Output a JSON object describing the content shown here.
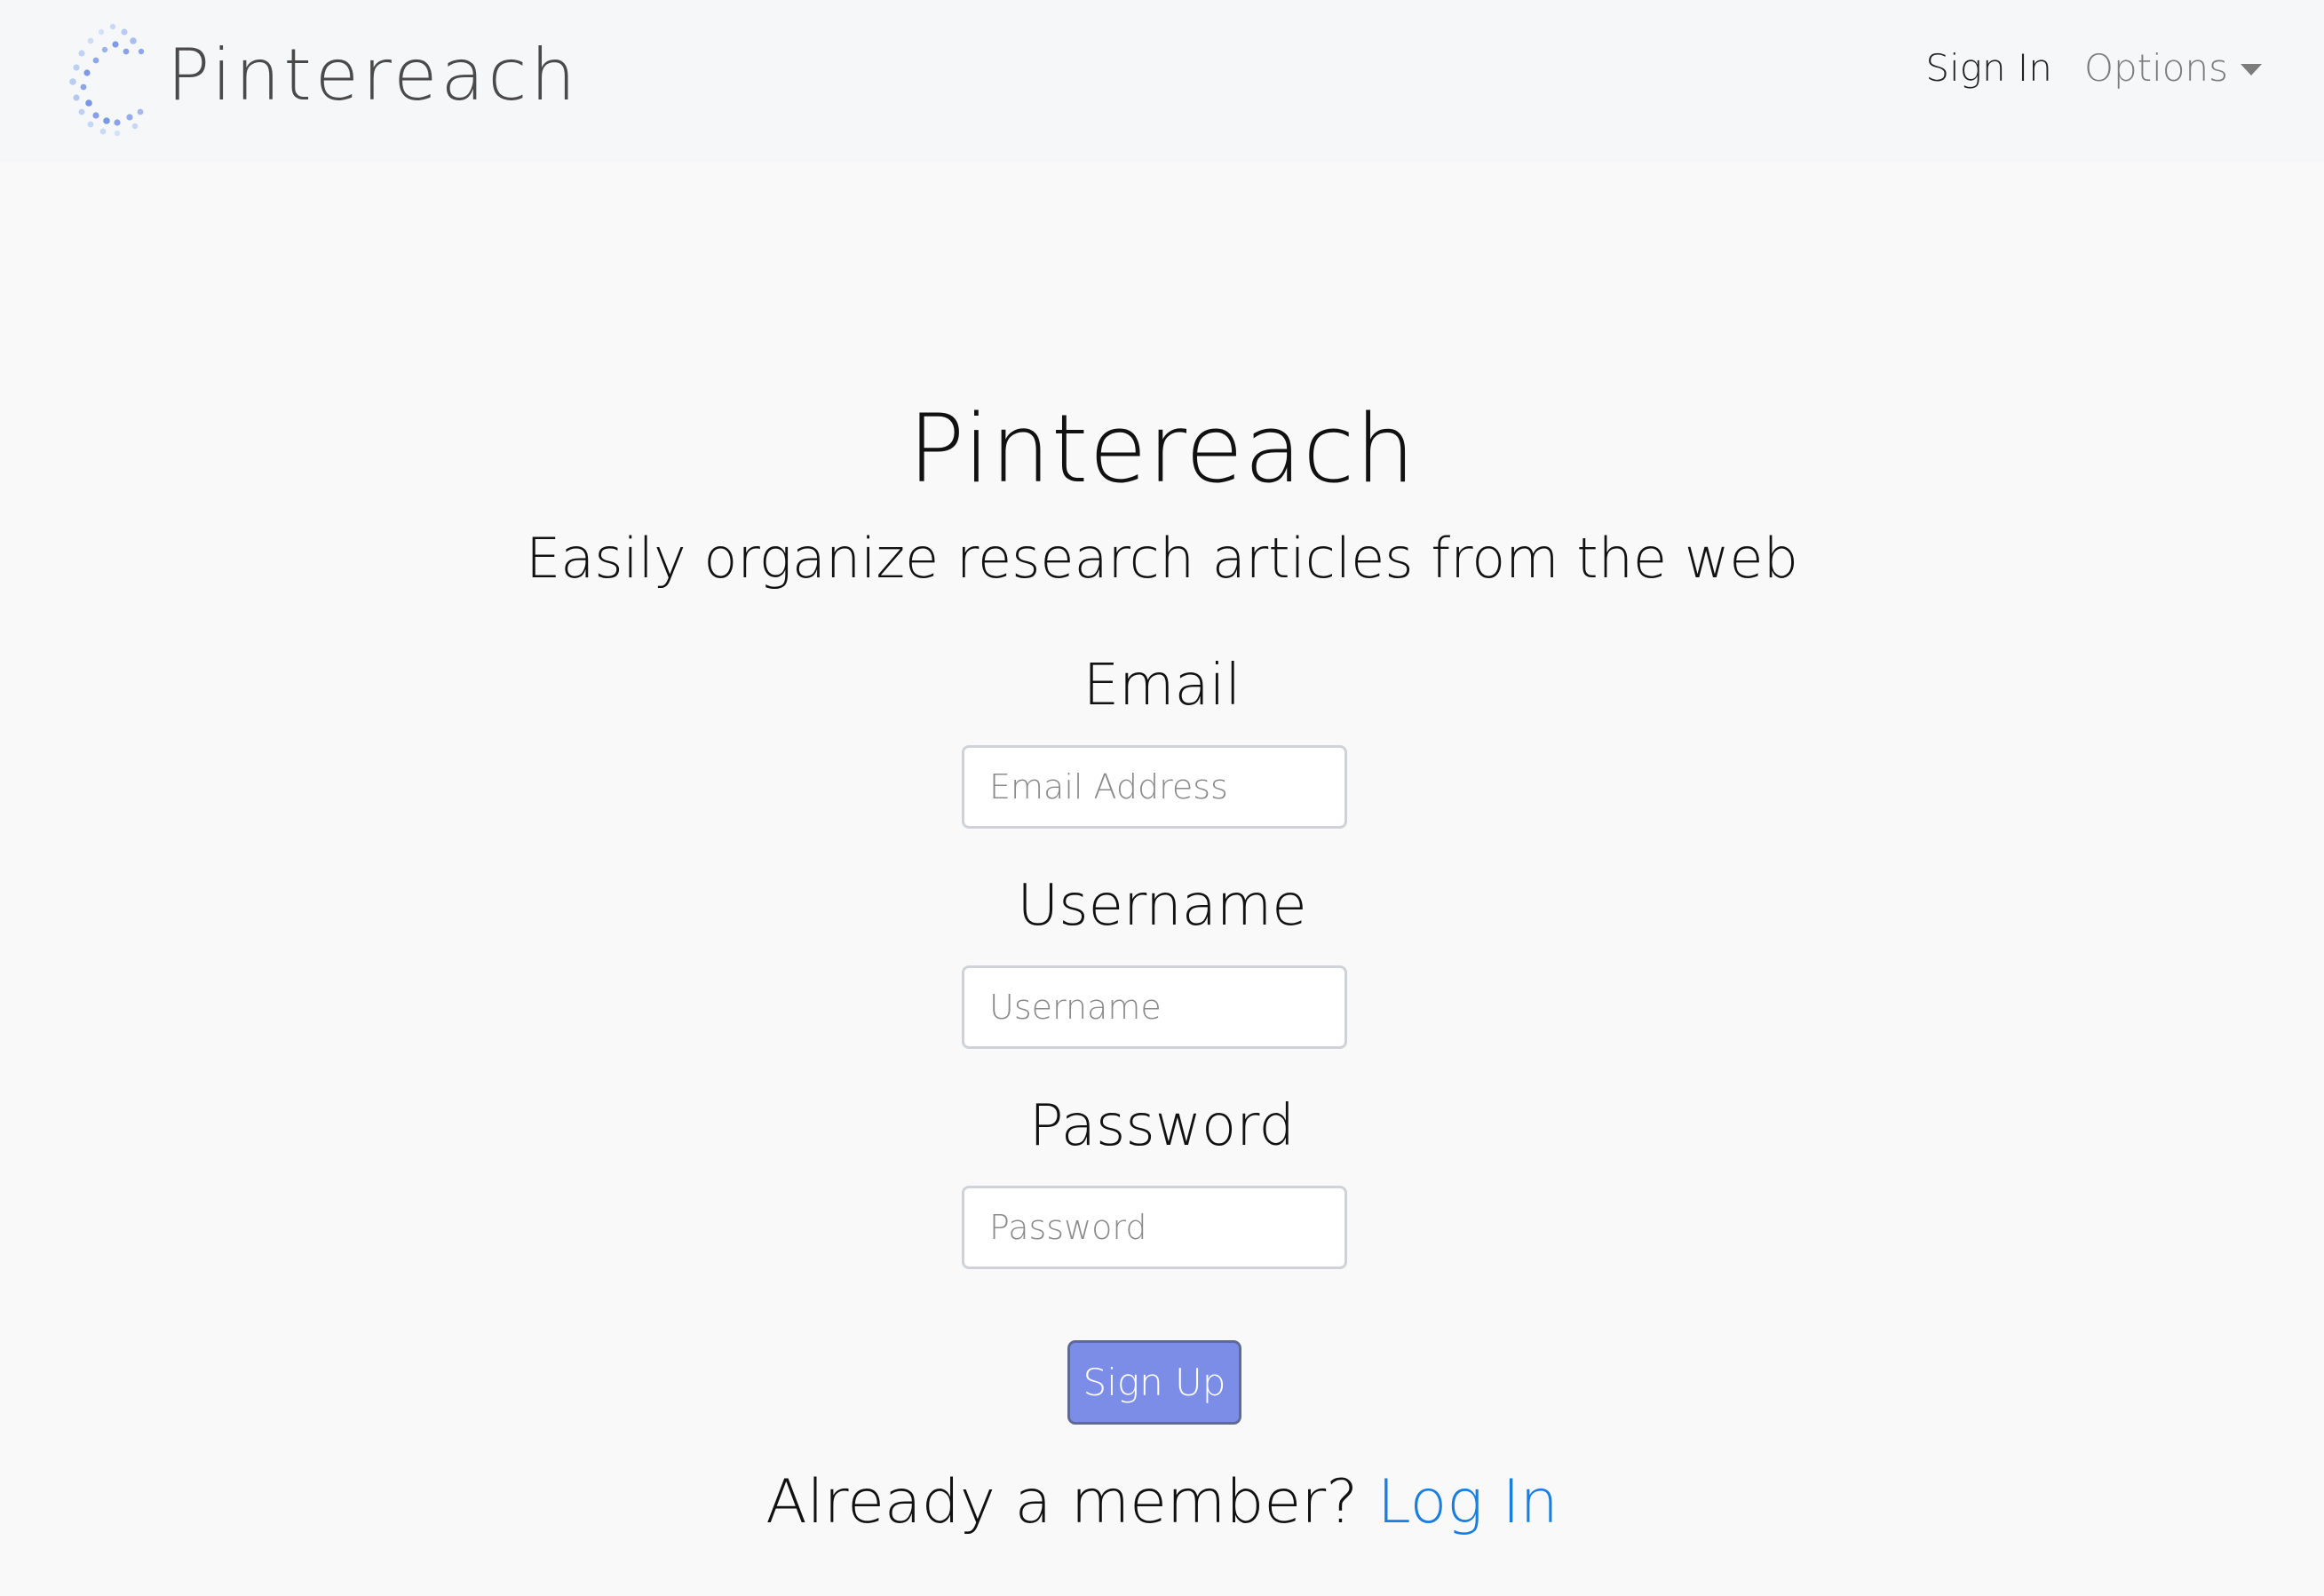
{
  "navbar": {
    "brand_name": "Pintereach",
    "signin_label": "Sign In",
    "options_label": "Options"
  },
  "hero": {
    "title": "Pintereach",
    "subtitle": "Easily organize research articles from the web"
  },
  "form": {
    "email": {
      "label": "Email",
      "placeholder": "Email Address",
      "value": ""
    },
    "username": {
      "label": "Username",
      "placeholder": "Username",
      "value": ""
    },
    "password": {
      "label": "Password",
      "placeholder": "Password",
      "value": ""
    },
    "submit_label": "Sign Up"
  },
  "footer": {
    "member_prompt": "Already a member?",
    "login_label": "Log In"
  },
  "colors": {
    "button_bg": "#7b8de6",
    "link": "#1a7de0",
    "navbar_bg": "#f6f7f9",
    "page_bg": "#f9f9f9"
  }
}
